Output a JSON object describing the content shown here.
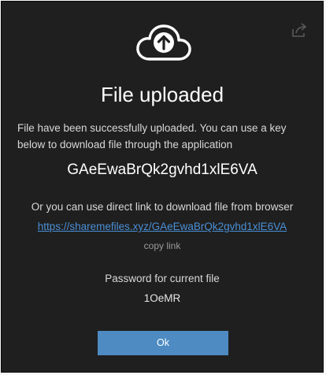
{
  "dialog": {
    "title": "File uploaded",
    "description": "File have been successfully uploaded. You can use a key below to download file through the application",
    "file_key": "GAeEwaBrQk2gvhd1xlE6VA",
    "alt_text": "Or you can use direct link to download file from browser",
    "direct_link": "https://sharemefiles.xyz/GAeEwaBrQk2gvhd1xlE6VA",
    "copy_link_label": "copy link",
    "password_label": "Password for current file",
    "password_value": "1OeMR",
    "ok_label": "Ok"
  },
  "icons": {
    "top_icon": "cloud-upload-icon",
    "share_icon": "share-icon"
  },
  "colors": {
    "background": "#1f1f1f",
    "link": "#4a8fd6",
    "button": "#4d8bc2"
  }
}
